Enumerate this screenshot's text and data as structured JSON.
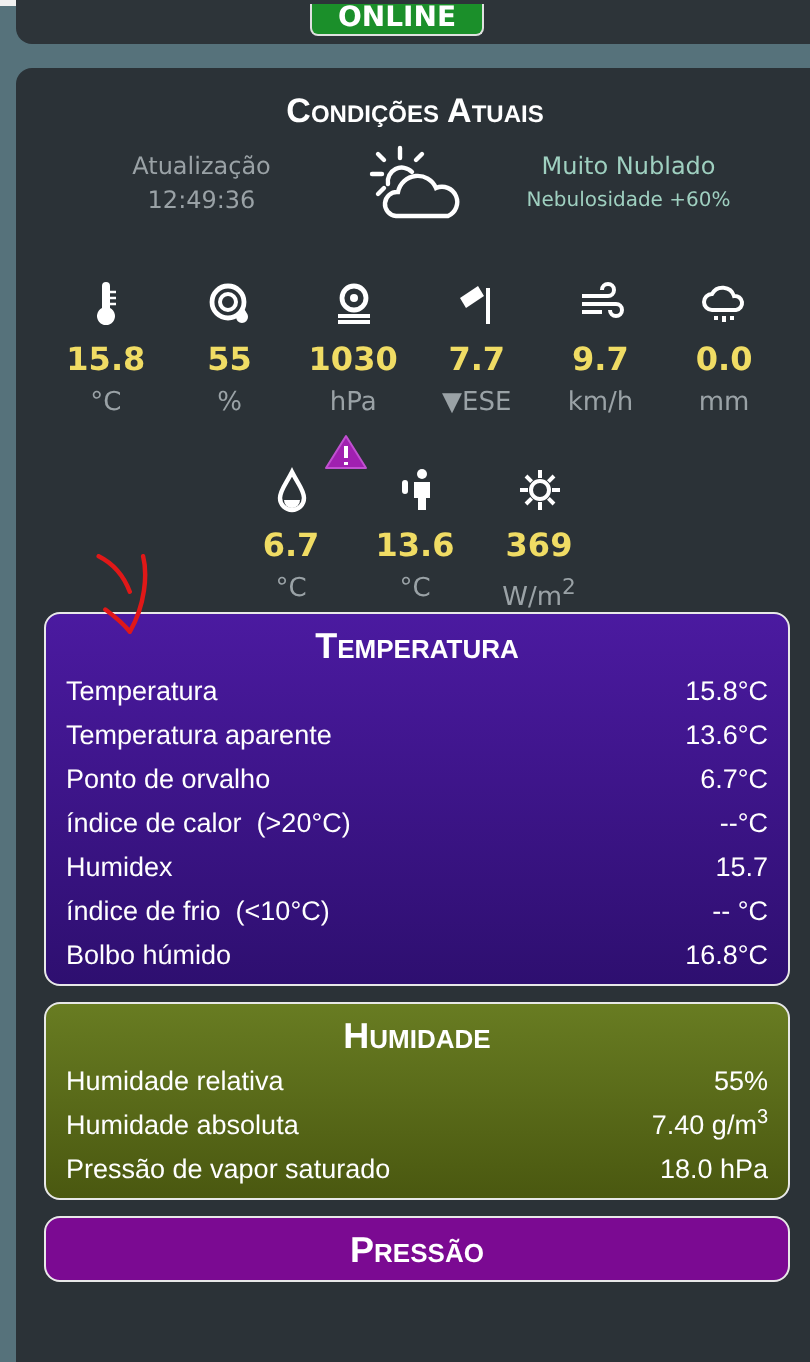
{
  "status_badge": "ONLINE",
  "current": {
    "title": "Condições Atuais",
    "update_label": "Atualização",
    "update_time": "12:49:36",
    "condition": "Muito Nublado",
    "cloud_cover": "Nebulosidade +60%",
    "metrics": [
      {
        "kind": "temperature",
        "value": "15.8",
        "unit": "°C"
      },
      {
        "kind": "humidity",
        "value": "55",
        "unit": "%"
      },
      {
        "kind": "pressure",
        "value": "1030",
        "unit": "hPa"
      },
      {
        "kind": "windsock",
        "value": "7.7",
        "unit": "▼ESE"
      },
      {
        "kind": "wind",
        "value": "9.7",
        "unit": "km/h"
      },
      {
        "kind": "rain",
        "value": "0.0",
        "unit": "mm"
      }
    ],
    "metrics_secondary": [
      {
        "kind": "dewpoint",
        "value": "6.7",
        "unit": "°C"
      },
      {
        "kind": "feels",
        "value": "13.6",
        "unit": "°C"
      },
      {
        "kind": "solar",
        "value": "369",
        "unit": "W/m$^{2}$"
      }
    ]
  },
  "sections": [
    {
      "kind": "temperature",
      "title": "Temperatura",
      "rows": [
        {
          "label": "Temperatura",
          "value": "15.8°C"
        },
        {
          "label": "Temperatura aparente",
          "value": "13.6°C"
        },
        {
          "label": "Ponto de orvalho",
          "value": "6.7°C"
        },
        {
          "label": "índice de calor  (>20°C)",
          "value": "--°C"
        },
        {
          "label": "Humidex",
          "value": "15.7"
        },
        {
          "label": "índice de frio  (<10°C)",
          "value": "-- °C"
        },
        {
          "label": "Bolbo húmido",
          "value": "16.8°C"
        }
      ]
    },
    {
      "kind": "humidity",
      "title": "Humidade",
      "rows": [
        {
          "label": "Humidade relativa",
          "value": "55%"
        },
        {
          "label": "Humidade absoluta",
          "value": "7.40 g/m$^{3}$"
        },
        {
          "label": "Pressão de vapor saturado",
          "value": "18.0 hPa"
        }
      ]
    },
    {
      "kind": "pressure",
      "title": "Pressão"
    }
  ]
}
